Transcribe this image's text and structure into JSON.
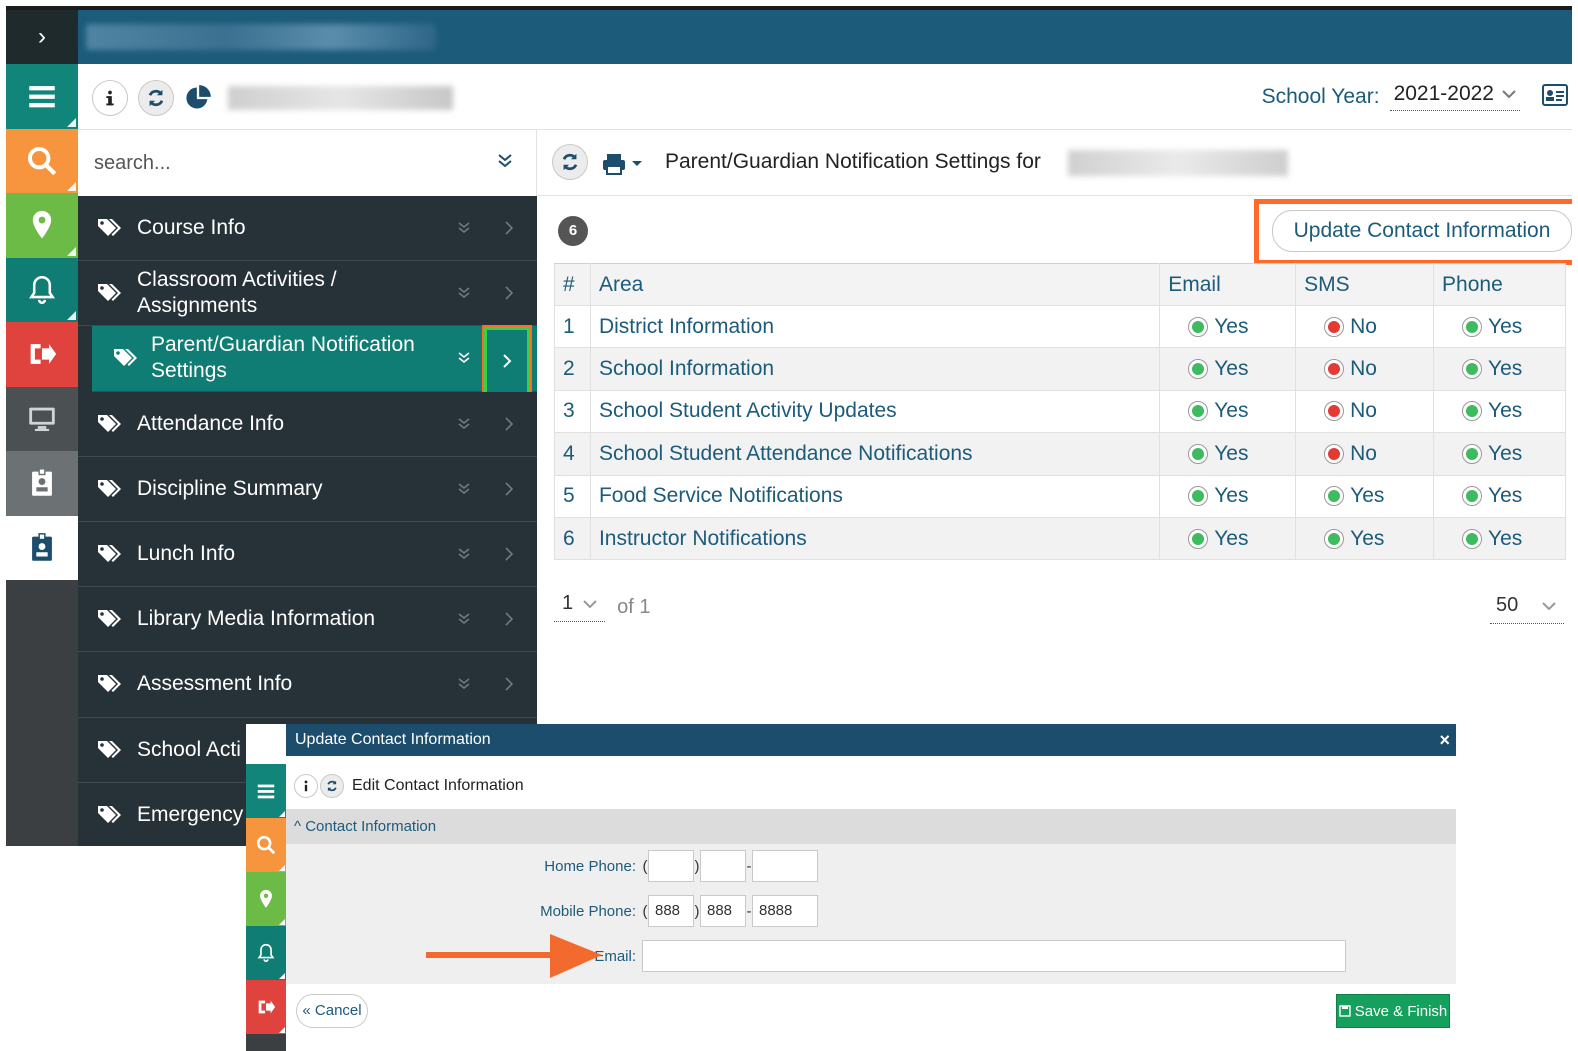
{
  "app": {
    "nav_toggle": "›",
    "search_placeholder": "search...",
    "school_year_label": "School Year:",
    "school_year_value": "2021-2022"
  },
  "nav": {
    "items": [
      {
        "label": "Course Info"
      },
      {
        "label": "Classroom Activities / Assignments"
      },
      {
        "label": "Parent/Guardian Notification Settings"
      },
      {
        "label": "Attendance Info"
      },
      {
        "label": "Discipline Summary"
      },
      {
        "label": "Lunch Info"
      },
      {
        "label": "Library Media Information"
      },
      {
        "label": "Assessment Info"
      },
      {
        "label": "School Acti"
      },
      {
        "label": "Emergency"
      }
    ]
  },
  "content": {
    "title": "Parent/Guardian Notification Settings for",
    "count": "6",
    "update_button": "Update Contact Information",
    "columns": {
      "num": "#",
      "area": "Area",
      "email": "Email",
      "sms": "SMS",
      "phone": "Phone"
    },
    "rows": [
      {
        "num": "1",
        "area": "District Information",
        "email": "Yes",
        "sms": "No",
        "phone": "Yes"
      },
      {
        "num": "2",
        "area": "School Information",
        "email": "Yes",
        "sms": "No",
        "phone": "Yes"
      },
      {
        "num": "3",
        "area": "School Student Activity Updates",
        "email": "Yes",
        "sms": "No",
        "phone": "Yes"
      },
      {
        "num": "4",
        "area": "School Student Attendance Notifications",
        "email": "Yes",
        "sms": "No",
        "phone": "Yes"
      },
      {
        "num": "5",
        "area": "Food Service Notifications",
        "email": "Yes",
        "sms": "Yes",
        "phone": "Yes"
      },
      {
        "num": "6",
        "area": "Instructor Notifications",
        "email": "Yes",
        "sms": "Yes",
        "phone": "Yes"
      }
    ],
    "pager": {
      "page": "1",
      "of": "of 1",
      "page_size": "50"
    }
  },
  "dialog": {
    "title": "Update Contact Information",
    "close": "×",
    "toolbar_title": "Edit Contact Information",
    "section": "^ Contact Information",
    "home_phone_label": "Home Phone:",
    "mobile_phone_label": "Mobile Phone:",
    "email_label": "Email:",
    "home_phone": {
      "area": "",
      "prefix": "",
      "line": ""
    },
    "mobile_phone": {
      "area": "888",
      "prefix": "888",
      "line": "8888"
    },
    "email_value": "",
    "cancel": "« Cancel",
    "save": "Save & Finish"
  },
  "colors": {
    "header_blue": "#1c5b7a",
    "nav_dark": "#263238",
    "active_teal": "#0f7d73",
    "highlight_orange": "#ff6a2b",
    "yes_green": "#3dbb5e",
    "no_red": "#e53935"
  }
}
